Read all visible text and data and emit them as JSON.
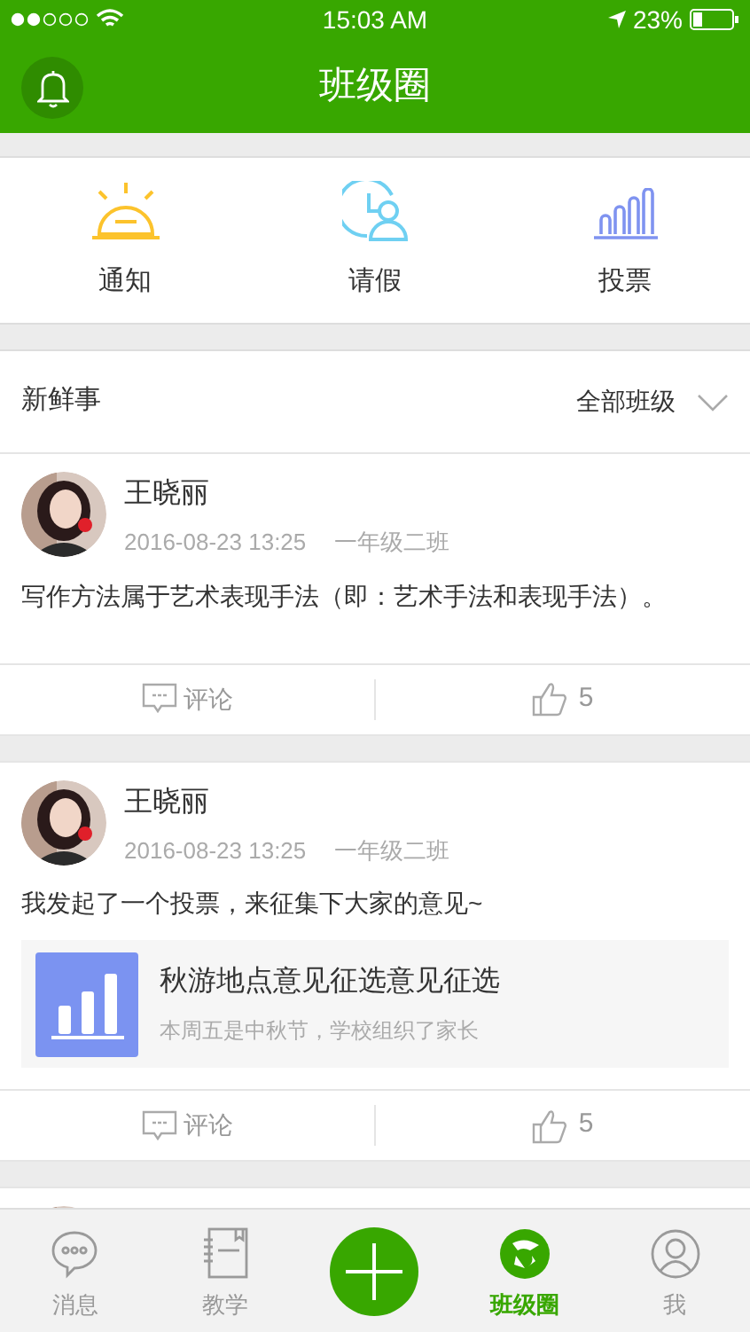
{
  "status_bar": {
    "time": "15:03 AM",
    "battery": "23%"
  },
  "header": {
    "title": "班级圈"
  },
  "shortcuts": [
    {
      "kind": "notice",
      "label": "通知"
    },
    {
      "kind": "leave",
      "label": "请假"
    },
    {
      "kind": "vote",
      "label": "投票"
    }
  ],
  "feed_header": {
    "title": "新鲜事",
    "filter": "全部班级"
  },
  "posts": [
    {
      "author": "王晓丽",
      "time": "2016-08-23 13:25",
      "class": "一年级二班",
      "text": "写作方法属于艺术表现手法（即：艺术手法和表现手法）。",
      "comment_label": "评论",
      "likes": "5"
    },
    {
      "author": "王晓丽",
      "time": "2016-08-23 13:25",
      "class": "一年级二班",
      "text": "我发起了一个投票，来征集下大家的意见~",
      "vote": {
        "title": "秋游地点意见征选意见征选",
        "summary": "本周五是中秋节，学校组织了家长"
      },
      "comment_label": "评论",
      "likes": "5"
    }
  ],
  "tab_bar": [
    {
      "kind": "chat",
      "label": "消息",
      "selected": false
    },
    {
      "kind": "book",
      "label": "教学",
      "selected": false
    },
    {
      "kind": "plus",
      "selected": false
    },
    {
      "kind": "circle",
      "label": "班级圈",
      "selected": true
    },
    {
      "kind": "person",
      "label": "我",
      "selected": false
    }
  ]
}
